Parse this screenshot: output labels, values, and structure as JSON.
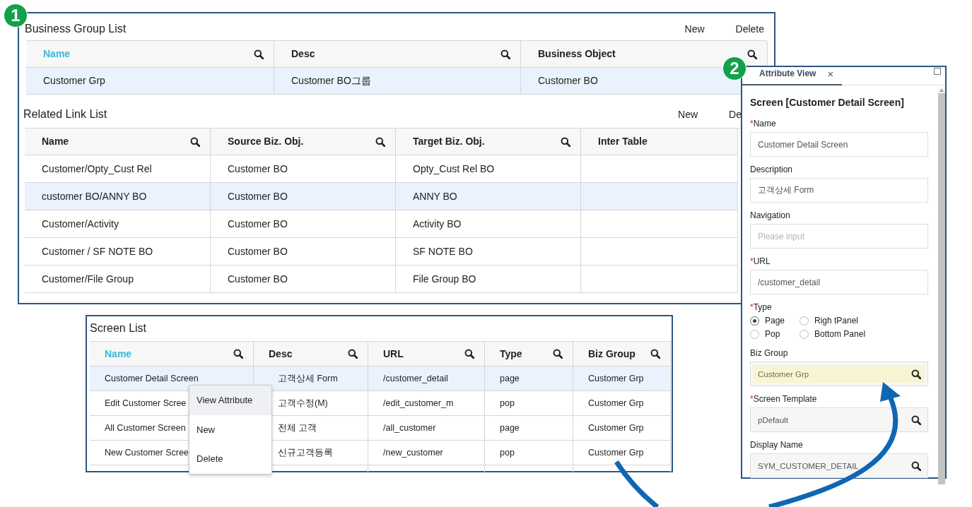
{
  "business_group_list": {
    "badge": "1",
    "title": "Business Group List",
    "actions": [
      "New",
      "Delete"
    ],
    "columns": [
      {
        "label": "Name",
        "active": true,
        "searchable": true
      },
      {
        "label": "Desc",
        "active": false,
        "searchable": true
      },
      {
        "label": "Business Object",
        "active": false,
        "searchable": true
      }
    ],
    "rows": [
      {
        "cells": [
          "Customer Grp",
          "Customer BO그룹",
          "Customer BO"
        ],
        "selected": true
      }
    ]
  },
  "related_link_list": {
    "title": "Related Link List",
    "actions": [
      "New",
      "De"
    ],
    "columns": [
      {
        "label": "Name",
        "active": false,
        "searchable": true
      },
      {
        "label": "Source Biz. Obj.",
        "active": false,
        "searchable": true
      },
      {
        "label": "Target Biz. Obj.",
        "active": false,
        "searchable": true
      },
      {
        "label": "Inter Table",
        "active": false,
        "searchable": false
      }
    ],
    "rows": [
      {
        "cells": [
          "Customer/Opty_Cust Rel",
          "Customer BO",
          "Opty_Cust Rel BO"
        ],
        "selected": false
      },
      {
        "cells": [
          "customer BO/ANNY BO",
          "Customer BO",
          "ANNY BO"
        ],
        "selected": true
      },
      {
        "cells": [
          "Customer/Activity",
          "Customer BO",
          "Activity BO"
        ],
        "selected": false
      },
      {
        "cells": [
          "Customer / SF NOTE BO",
          "Customer BO",
          "SF NOTE BO"
        ],
        "selected": false
      },
      {
        "cells": [
          "Customer/File Group",
          "Customer BO",
          "File Group BO"
        ],
        "selected": false
      }
    ]
  },
  "screen_list": {
    "title": "Screen List",
    "columns": [
      {
        "label": "Name",
        "active": true,
        "searchable": true
      },
      {
        "label": "Desc",
        "active": false,
        "searchable": true
      },
      {
        "label": "URL",
        "active": false,
        "searchable": true
      },
      {
        "label": "Type",
        "active": false,
        "searchable": true
      },
      {
        "label": "Biz Group",
        "active": false,
        "searchable": true
      }
    ],
    "rows": [
      {
        "cells": [
          "Customer Detail Screen",
          "고객상세 Form",
          "/customer_detail",
          "page",
          "Customer Grp"
        ],
        "selected": true
      },
      {
        "cells": [
          "Edit Customer Scree",
          "고객수정(M)",
          "/edit_customer_m",
          "pop",
          "Customer Grp"
        ],
        "selected": false
      },
      {
        "cells": [
          "All Customer Screen",
          "전체 고객",
          "/all_customer",
          "page",
          "Customer Grp"
        ],
        "selected": false
      },
      {
        "cells": [
          "New Customer Scree",
          "신규고객등록",
          "/new_customer",
          "pop",
          "Customer Grp"
        ],
        "selected": false
      }
    ]
  },
  "context_menu": {
    "items": [
      {
        "label": "View Attribute",
        "selected": true
      },
      {
        "label": "New",
        "selected": false
      },
      {
        "label": "Delete",
        "selected": false
      }
    ]
  },
  "attribute_view": {
    "badge": "2",
    "tab": "Attribute View",
    "close": "×",
    "heading": "Screen [Customer Detail Screen]",
    "fields": [
      {
        "kind": "text",
        "mark": "*",
        "label": "Name",
        "value": "Customer Detail Screen"
      },
      {
        "kind": "text",
        "label": "Description",
        "value": "고객상세 Form"
      },
      {
        "kind": "text",
        "label": "Navigation",
        "placeholder": "Please input"
      },
      {
        "kind": "text",
        "mark": "*",
        "label": "URL",
        "value": "/customer_detail"
      },
      {
        "kind": "radio",
        "mark": "*",
        "label": "Type",
        "options": [
          {
            "label": "Page",
            "selected": true
          },
          {
            "label": "Righ tPanel",
            "selected": false
          },
          {
            "label": "Pop",
            "selected": false
          },
          {
            "label": "Bottom Panel",
            "selected": false
          }
        ]
      },
      {
        "kind": "lookup",
        "label": "Biz Group",
        "value": "Customer Grp",
        "highlighted": true
      },
      {
        "kind": "lookup",
        "mark": "*",
        "label": "Screen Template",
        "value": "pDefault",
        "highlighted": false
      },
      {
        "kind": "lookup",
        "label": "Display Name",
        "value": "SYM_CUSTOMER_DETAIL",
        "highlighted": false
      }
    ]
  }
}
